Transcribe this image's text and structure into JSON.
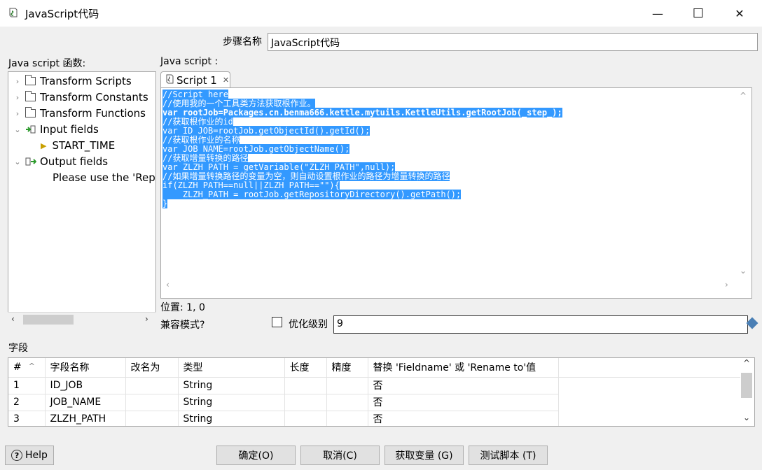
{
  "window": {
    "title": "JavaScript代码",
    "minimize": "—",
    "maximize": "☐",
    "close": "✕"
  },
  "step_name": {
    "label": "步骤名称",
    "value": "JavaScript代码"
  },
  "functions_panel": {
    "label": "Java script 函数:",
    "items": [
      {
        "label": "Transform Scripts"
      },
      {
        "label": "Transform Constants"
      },
      {
        "label": "Transform Functions"
      },
      {
        "label": "Input fields"
      },
      {
        "label": "START_TIME"
      },
      {
        "label": "Output fields"
      },
      {
        "label": "Please use the 'Repla"
      }
    ]
  },
  "script_panel": {
    "label": "Java script :",
    "tab_label": "Script 1",
    "code_lines": [
      "//Script here",
      "//使用我的一个工具类方法获取根作业。",
      "var rootJob=Packages.cn.benma666.kettle.mytuils.KettleUtils.getRootJob(_step_);",
      "//获取根作业的id",
      "var ID_JOB=rootJob.getObjectId().getId();",
      "//获取根作业的名称",
      "var JOB_NAME=rootJob.getObjectName();",
      "//获取增量转换的路径",
      "var ZLZH_PATH = getVariable(\"ZLZH_PATH\",null);",
      "//如果增量转换路径的变量为空，则自动设置根作业的路径为增量转换的路径",
      "if(ZLZH_PATH==null||ZLZH_PATH==\"\"){",
      "    ZLZH_PATH = rootJob.getRepositoryDirectory().getPath();",
      "}"
    ]
  },
  "position": "位置: 1, 0",
  "compat_label": "兼容模式?",
  "optimization": {
    "label": "优化级别",
    "value": "9"
  },
  "fields": {
    "label": "字段",
    "columns": [
      "#",
      "字段名称",
      "改名为",
      "类型",
      "长度",
      "精度",
      "替换 'Fieldname' 或 'Rename to'值"
    ],
    "rows": [
      [
        "1",
        "ID_JOB",
        "",
        "String",
        "",
        "",
        "否"
      ],
      [
        "2",
        "JOB_NAME",
        "",
        "String",
        "",
        "",
        "否"
      ],
      [
        "3",
        "ZLZH_PATH",
        "",
        "String",
        "",
        "",
        "否"
      ]
    ]
  },
  "buttons": {
    "help": "Help",
    "ok": "确定(O)",
    "cancel": "取消(C)",
    "get_vars": "获取变量 (G)",
    "test": "测试脚本 (T)"
  },
  "colors": {
    "selection": "#3399ff",
    "accent_icon": "#4a7fb5"
  }
}
